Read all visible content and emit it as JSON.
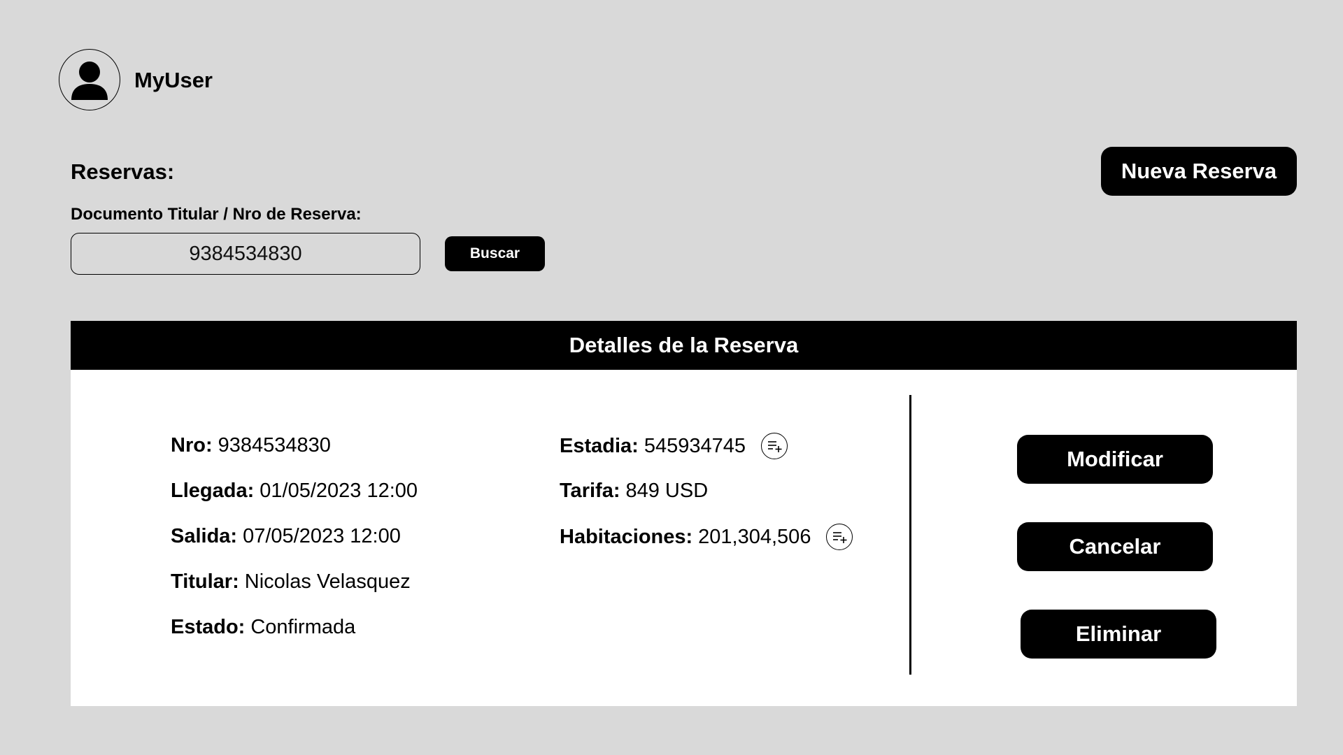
{
  "user": {
    "name": "MyUser"
  },
  "reservas": {
    "title": "Reservas:",
    "new_button": "Nueva Reserva"
  },
  "search": {
    "label": "Documento Titular / Nro de Reserva:",
    "value": "9384534830",
    "button": "Buscar"
  },
  "details": {
    "header": "Detalles de la Reserva",
    "left": [
      {
        "label": "Nro:",
        "value": "9384534830"
      },
      {
        "label": "Llegada:",
        "value": "01/05/2023 12:00"
      },
      {
        "label": "Salida:",
        "value": "07/05/2023 12:00"
      },
      {
        "label": "Titular:",
        "value": "Nicolas Velasquez"
      },
      {
        "label": "Estado:",
        "value": "Confirmada"
      }
    ],
    "right": [
      {
        "label": "Estadia:",
        "value": "545934745",
        "icon": "playlist-add-icon"
      },
      {
        "label": "Tarifa:",
        "value": "849 USD"
      },
      {
        "label": "Habitaciones:",
        "value": "201,304,506",
        "icon": "playlist-add-icon"
      }
    ]
  },
  "actions": {
    "modify": "Modificar",
    "cancel": "Cancelar",
    "delete": "Eliminar"
  },
  "colors": {
    "background": "#d9d9d9",
    "panel": "#ffffff",
    "primary": "#000000",
    "button_text": "#ffffff"
  }
}
